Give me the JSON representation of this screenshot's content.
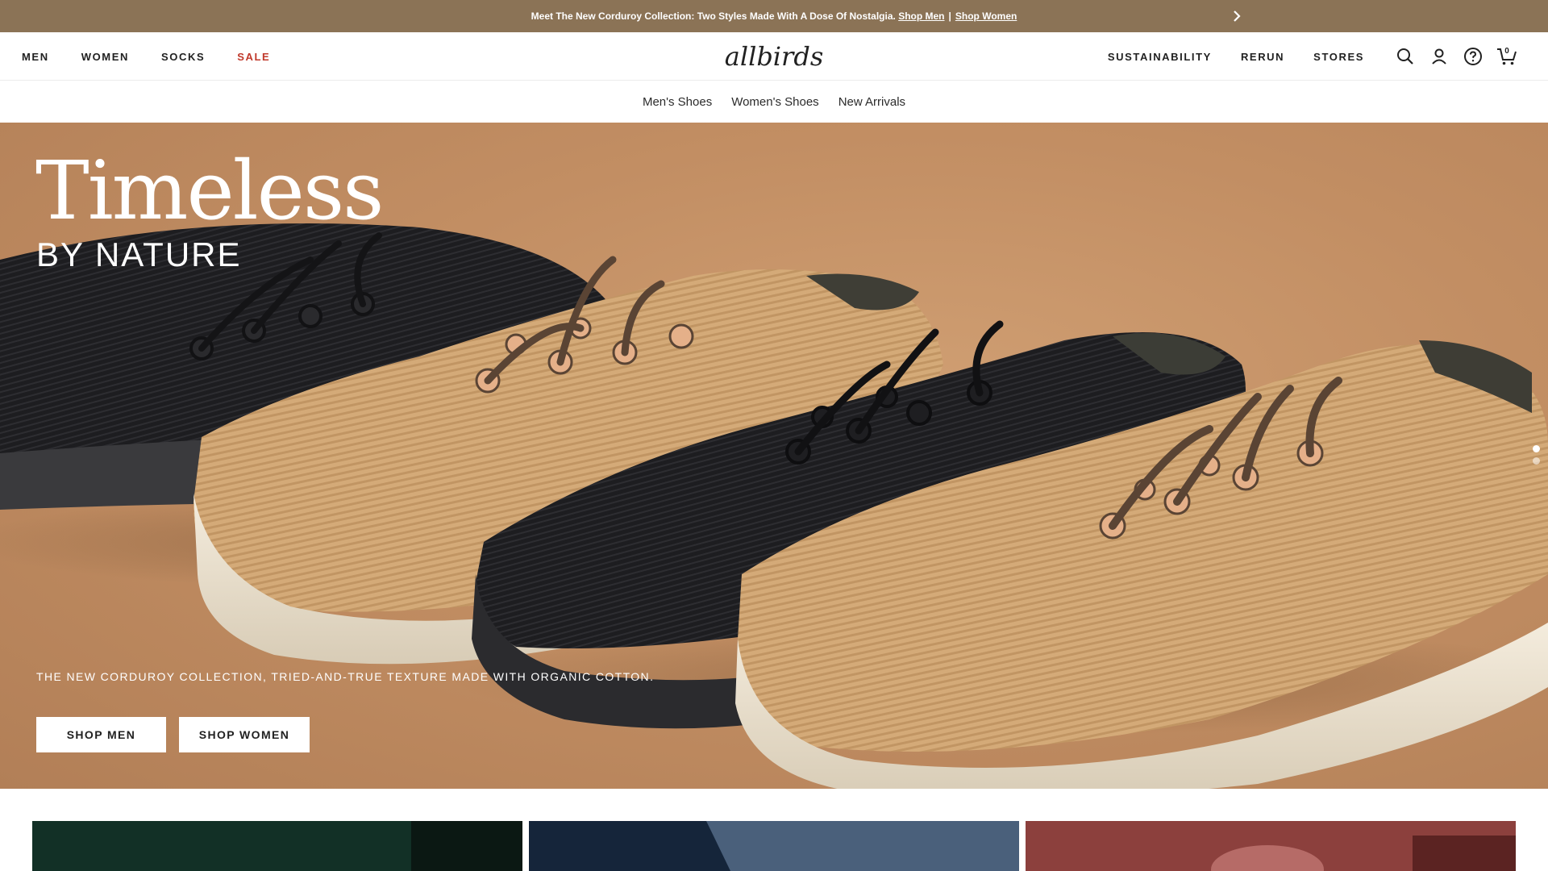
{
  "announcement": {
    "text": "Meet The New Corduroy Collection: Two Styles Made With A Dose Of Nostalgia.",
    "link_men": "Shop Men",
    "separator": "|",
    "link_women": "Shop Women",
    "next_icon": "chevron-right-icon"
  },
  "header": {
    "nav_left": [
      "MEN",
      "WOMEN",
      "SOCKS",
      "SALE"
    ],
    "logo": "allbirds",
    "nav_right": [
      "SUSTAINABILITY",
      "RERUN",
      "STORES"
    ],
    "icons": [
      "search-icon",
      "account-icon",
      "help-icon",
      "cart-icon"
    ],
    "cart_count": "0"
  },
  "subnav": [
    "Men's Shoes",
    "Women's Shoes",
    "New Arrivals"
  ],
  "hero": {
    "title": "Timeless",
    "subtitle": "BY NATURE",
    "tagline": "THE NEW CORDUROY COLLECTION, TRIED-AND-TRUE TEXTURE MADE WITH ORGANIC COTTON.",
    "btn_men": "SHOP MEN",
    "btn_women": "SHOP WOMEN",
    "slides_total": 2,
    "slide_active": 1
  },
  "colors": {
    "announcement_bg": "#8b7356",
    "sale": "#c0392b",
    "hero_bg": "#c28e63"
  }
}
